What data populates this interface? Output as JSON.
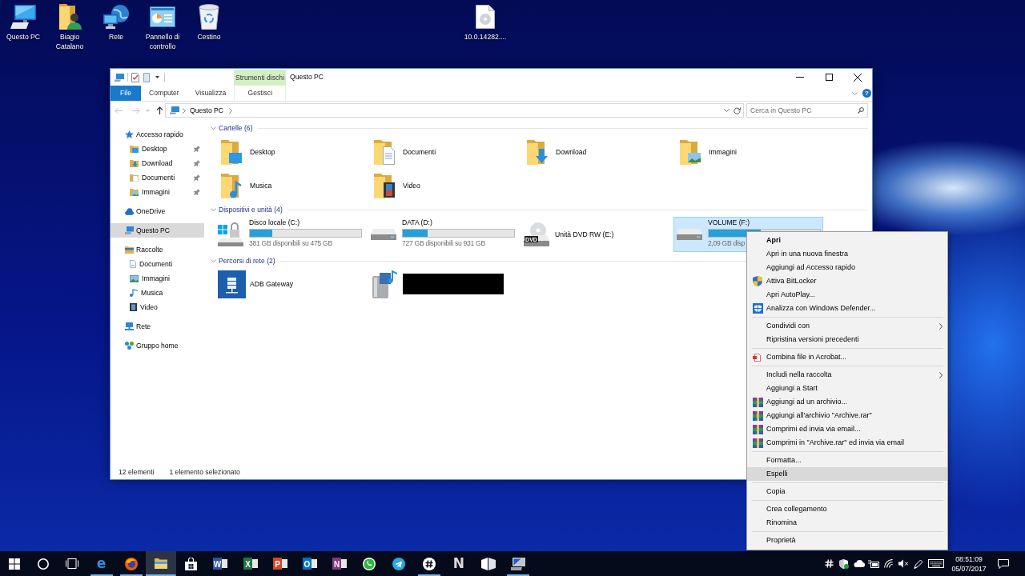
{
  "desktop_icons": [
    {
      "kind": "monitor",
      "label": "Questo PC"
    },
    {
      "kind": "user-folder",
      "label": "Biagio Catalano"
    },
    {
      "kind": "globe-monitor",
      "label": "Rete"
    },
    {
      "kind": "control-panel",
      "label": "Pannello di controllo"
    },
    {
      "kind": "bin",
      "label": "Cestino"
    }
  ],
  "desktop_file": {
    "label": "10.0.14282...."
  },
  "explorer": {
    "title": "Questo PC",
    "context_group": "Strumenti dischi",
    "ribbon_tabs": [
      {
        "label": "File",
        "kind": "backstage",
        "selected": false
      },
      {
        "label": "Computer",
        "kind": "tab",
        "selected": false
      },
      {
        "label": "Visualizza",
        "kind": "tab",
        "selected": false
      },
      {
        "label": "Gestisci",
        "kind": "contextual",
        "selected": false
      }
    ],
    "help": "?",
    "nav_buttons": [
      {
        "kind": "back",
        "disabled": true
      },
      {
        "kind": "forward",
        "disabled": true
      },
      {
        "kind": "recent",
        "disabled": true
      },
      {
        "kind": "up",
        "disabled": false
      }
    ],
    "address": [
      "Questo PC"
    ],
    "search": {
      "placeholder": "Cerca in Questo PC"
    },
    "nav": [
      {
        "label": "Accesso rapido",
        "kind": "star",
        "selected": false,
        "children": [
          {
            "label": "Desktop",
            "kind": "desktop",
            "pinned": true,
            "selected": false
          },
          {
            "label": "Download",
            "kind": "download",
            "pinned": true,
            "selected": false
          },
          {
            "label": "Documenti",
            "kind": "documents",
            "pinned": true,
            "selected": false
          },
          {
            "label": "Immagini",
            "kind": "pictures",
            "pinned": true,
            "selected": false
          }
        ]
      },
      {
        "label": "OneDrive",
        "kind": "cloud",
        "selected": false
      },
      {
        "label": "Questo PC",
        "kind": "pc",
        "selected": true
      },
      {
        "label": "Raccolte",
        "kind": "libraries",
        "selected": false,
        "children": [
          {
            "label": "Documenti",
            "kind": "lib-documents",
            "pinned": false,
            "selected": false
          },
          {
            "label": "Immagini",
            "kind": "lib-pictures",
            "pinned": false,
            "selected": false
          },
          {
            "label": "Musica",
            "kind": "lib-music",
            "pinned": false,
            "selected": false
          },
          {
            "label": "Video",
            "kind": "lib-video",
            "pinned": false,
            "selected": false
          }
        ]
      },
      {
        "label": "Rete",
        "kind": "network",
        "selected": false
      },
      {
        "label": "Gruppo home",
        "kind": "homegroup",
        "selected": false
      }
    ],
    "groups": [
      {
        "title": "Cartelle (6)",
        "kind": "folders",
        "expanded": true,
        "items": [
          {
            "label": "Desktop",
            "kind": "desktop",
            "selected": false
          },
          {
            "label": "Documenti",
            "kind": "documents",
            "selected": false
          },
          {
            "label": "Download",
            "kind": "download",
            "selected": false
          },
          {
            "label": "Immagini",
            "kind": "pictures",
            "selected": false
          },
          {
            "label": "Musica",
            "kind": "music",
            "selected": false
          },
          {
            "label": "Video",
            "kind": "video",
            "selected": false
          }
        ]
      },
      {
        "title": "Dispositivi e unità (4)",
        "kind": "drives",
        "expanded": true,
        "items": [
          {
            "label": "Disco locale (C:)",
            "kind": "system",
            "level": 0.2,
            "space": "381 GB disponibili su 475 GB",
            "selected": false
          },
          {
            "label": "DATA (D:)",
            "kind": "disk",
            "level": 0.22,
            "space": "727 GB disponibili su 931 GB",
            "selected": false
          },
          {
            "label": "Unità DVD RW (E:)",
            "kind": "dvd",
            "badge": "DVD",
            "selected": false
          },
          {
            "label": "VOLUME (F:)",
            "kind": "disk",
            "level": 0.47,
            "space": "2,09 GB disp",
            "selected": true
          }
        ]
      },
      {
        "title": "Percorsi di rete (2)",
        "kind": "network",
        "expanded": true,
        "items": [
          {
            "label": "ADB Gateway",
            "kind": "gateway",
            "selected": false
          },
          {
            "kind": "media-server",
            "redacted": true,
            "selected": false
          }
        ]
      }
    ],
    "status_bar": [
      "12 elementi",
      "1 elemento selezionato"
    ]
  },
  "context_menu": {
    "items": [
      {
        "label": "Apri",
        "kind": "default",
        "selected": false
      },
      {
        "label": "Apri in una nuova finestra",
        "kind": "item",
        "selected": false
      },
      {
        "label": "Aggiungi ad Accesso rapido",
        "kind": "item",
        "selected": false
      },
      {
        "label": "Attiva BitLocker",
        "kind": "uac-shield",
        "selected": false
      },
      {
        "label": "Apri AutoPlay...",
        "kind": "item",
        "selected": false
      },
      {
        "label": "Analizza con Windows Defender...",
        "kind": "defender",
        "selected": false
      },
      {
        "kind": "separator"
      },
      {
        "label": "Condividi con",
        "kind": "submenu",
        "selected": false
      },
      {
        "label": "Ripristina versioni precedenti",
        "kind": "item",
        "selected": false
      },
      {
        "kind": "separator"
      },
      {
        "label": "Combina file in Acrobat...",
        "kind": "acrobat",
        "selected": false
      },
      {
        "kind": "separator"
      },
      {
        "label": "Includi nella raccolta",
        "kind": "submenu",
        "selected": false
      },
      {
        "label": "Aggiungi a Start",
        "kind": "item",
        "selected": false
      },
      {
        "label": "Aggiungi ad un archivio...",
        "kind": "archive",
        "selected": false
      },
      {
        "label": "Aggiungi all'archivio \"Archive.rar\"",
        "kind": "archive",
        "selected": false
      },
      {
        "label": "Comprimi ed invia via email...",
        "kind": "archive",
        "selected": false
      },
      {
        "label": "Comprimi in \"Archive.rar\" ed invia via email",
        "kind": "archive",
        "selected": false
      },
      {
        "kind": "separator"
      },
      {
        "label": "Formatta...",
        "kind": "item",
        "selected": false
      },
      {
        "label": "Espelli",
        "kind": "item",
        "selected": true
      },
      {
        "kind": "separator"
      },
      {
        "label": "Copia",
        "kind": "item",
        "selected": false
      },
      {
        "kind": "separator"
      },
      {
        "label": "Crea collegamento",
        "kind": "item",
        "selected": false
      },
      {
        "label": "Rinomina",
        "kind": "item",
        "selected": false
      },
      {
        "kind": "separator"
      },
      {
        "label": "Proprietà",
        "kind": "item",
        "selected": false
      }
    ]
  },
  "taskbar": {
    "system": [
      {
        "kind": "start"
      },
      {
        "kind": "ring"
      },
      {
        "kind": "task-view"
      }
    ],
    "apps": [
      {
        "kind": "letter",
        "glyph": "e",
        "color": "#2f8fde",
        "running": true,
        "active": false
      },
      {
        "kind": "globe",
        "running": true,
        "active": false
      },
      {
        "kind": "folder",
        "running": true,
        "active": true
      },
      {
        "kind": "bag",
        "running": false,
        "active": false
      },
      {
        "kind": "tile",
        "glyph": "W",
        "color": "#2b579a",
        "running": false,
        "active": false
      },
      {
        "kind": "tile",
        "glyph": "X",
        "color": "#217346",
        "running": false,
        "active": false
      },
      {
        "kind": "tile",
        "glyph": "P",
        "color": "#d24726",
        "running": false,
        "active": false
      },
      {
        "kind": "tile",
        "glyph": "O",
        "color": "#0072c6",
        "running": false,
        "active": false
      },
      {
        "kind": "tile",
        "glyph": "N",
        "color": "#80397b",
        "running": false,
        "active": false
      },
      {
        "kind": "phone-bubble",
        "color": "#2cb742",
        "running": false,
        "active": false
      },
      {
        "kind": "paper-plane",
        "color": "#2ca5e0",
        "running": false,
        "active": false
      },
      {
        "kind": "hash-disc",
        "running": true,
        "active": false
      },
      {
        "kind": "letter",
        "glyph": "N",
        "color": "#d8d8d8",
        "running": false,
        "active": false
      },
      {
        "kind": "panels",
        "running": false,
        "active": false
      },
      {
        "kind": "monitor",
        "running": true,
        "active": false
      }
    ],
    "tray": [
      {
        "kind": "hash"
      },
      {
        "kind": "shield-check"
      },
      {
        "kind": "cloud"
      },
      {
        "kind": "plug"
      },
      {
        "kind": "wifi"
      },
      {
        "kind": "speaker-muted"
      },
      {
        "kind": "pen"
      },
      {
        "kind": "keyboard"
      }
    ],
    "time": "08:51:09",
    "date": "05/07/2017"
  }
}
